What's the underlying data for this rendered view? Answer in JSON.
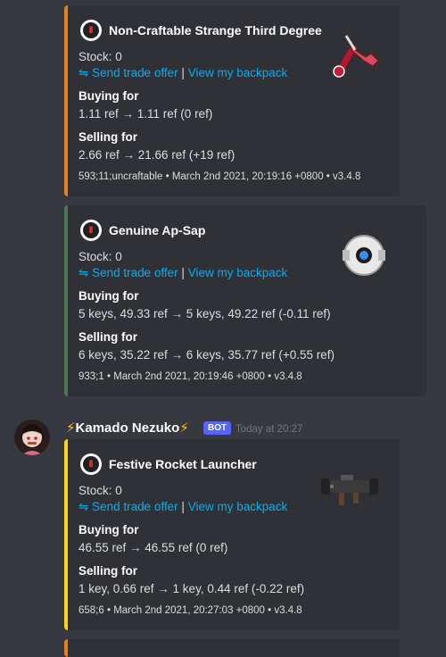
{
  "colors": {
    "accent_orange": "#e67e22",
    "accent_green": "#4d7455",
    "accent_yellow": "#fad31d",
    "link": "#00aff4",
    "bot_tag": "#5865f2"
  },
  "embeds": [
    {
      "title": "Non-Craftable Strange Third Degree",
      "stock": "Stock: 0",
      "send_offer": "⇋ Send trade offer",
      "separator": "|",
      "view_backpack": "View my backpack",
      "buying_label": "Buying for",
      "buying_value": "1.11 ref → 1.11 ref (0 ref)",
      "selling_label": "Selling for",
      "selling_value": "2.66 ref → 21.66 ref (+19 ref)",
      "footer": "593;11;uncraftable • March 2nd 2021, 20:19:16 +0800 • v3.4.8",
      "thumbnail_icon": "third-degree-weapon-icon"
    },
    {
      "title": "Genuine Ap-Sap",
      "stock": "Stock: 0",
      "send_offer": "⇋ Send trade offer",
      "separator": "|",
      "view_backpack": "View my backpack",
      "buying_label": "Buying for",
      "buying_value": "5 keys, 49.33 ref → 5 keys, 49.22 ref (-0.11 ref)",
      "selling_label": "Selling for",
      "selling_value": "6 keys, 35.22 ref → 6 keys, 35.77 ref (+0.55 ref)",
      "footer": "933;1 • March 2nd 2021, 20:19:46 +0800 • v3.4.8",
      "thumbnail_icon": "ap-sap-icon"
    },
    {
      "title": "Festive Rocket Launcher",
      "stock": "Stock: 0",
      "send_offer": "⇋ Send trade offer",
      "separator": "|",
      "view_backpack": "View my backpack",
      "buying_label": "Buying for",
      "buying_value": "46.55 ref → 46.55 ref (0 ref)",
      "selling_label": "Selling for",
      "selling_value": "1 key, 0.66 ref → 1 key, 0.44 ref (-0.22 ref)",
      "footer": "658;6 • March 2nd 2021, 20:27:03 +0800 • v3.4.8",
      "thumbnail_icon": "rocket-launcher-icon"
    }
  ],
  "message": {
    "bolt": "⚡",
    "username": "Kamado Nezuko",
    "bot_tag": "BOT",
    "timestamp": "Today at 20:27"
  }
}
